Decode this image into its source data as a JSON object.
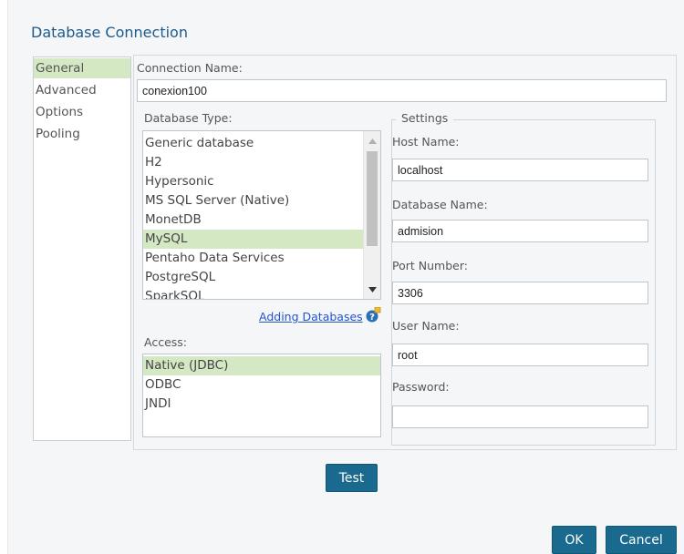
{
  "dialog": {
    "title": "Database Connection"
  },
  "nav": {
    "items": [
      {
        "label": "General",
        "selected": true
      },
      {
        "label": "Advanced",
        "selected": false
      },
      {
        "label": "Options",
        "selected": false
      },
      {
        "label": "Pooling",
        "selected": false
      }
    ]
  },
  "connection": {
    "label": "Connection Name:",
    "value": "conexion100"
  },
  "database_type": {
    "label": "Database Type:",
    "items": [
      "Generic database",
      "H2",
      "Hypersonic",
      "MS SQL Server (Native)",
      "MonetDB",
      "MySQL",
      "Pentaho Data Services",
      "PostgreSQL",
      "SparkSQL"
    ],
    "selected": "MySQL",
    "help_link": "Adding Databases"
  },
  "access": {
    "label": "Access:",
    "items": [
      "Native (JDBC)",
      "ODBC",
      "JNDI"
    ],
    "selected": "Native (JDBC)"
  },
  "settings": {
    "legend": "Settings",
    "host_label": "Host Name:",
    "host_value": "localhost",
    "dbname_label": "Database Name:",
    "dbname_value": "admision",
    "port_label": "Port Number:",
    "port_value": "3306",
    "user_label": "User Name:",
    "user_value": "root",
    "password_label": "Password:",
    "password_value": ""
  },
  "buttons": {
    "test": "Test",
    "ok": "OK",
    "cancel": "Cancel"
  },
  "colors": {
    "accent": "#1a6a8f",
    "selection": "#d5e8c4",
    "title": "#1e5a8a",
    "link": "#2255cc"
  }
}
